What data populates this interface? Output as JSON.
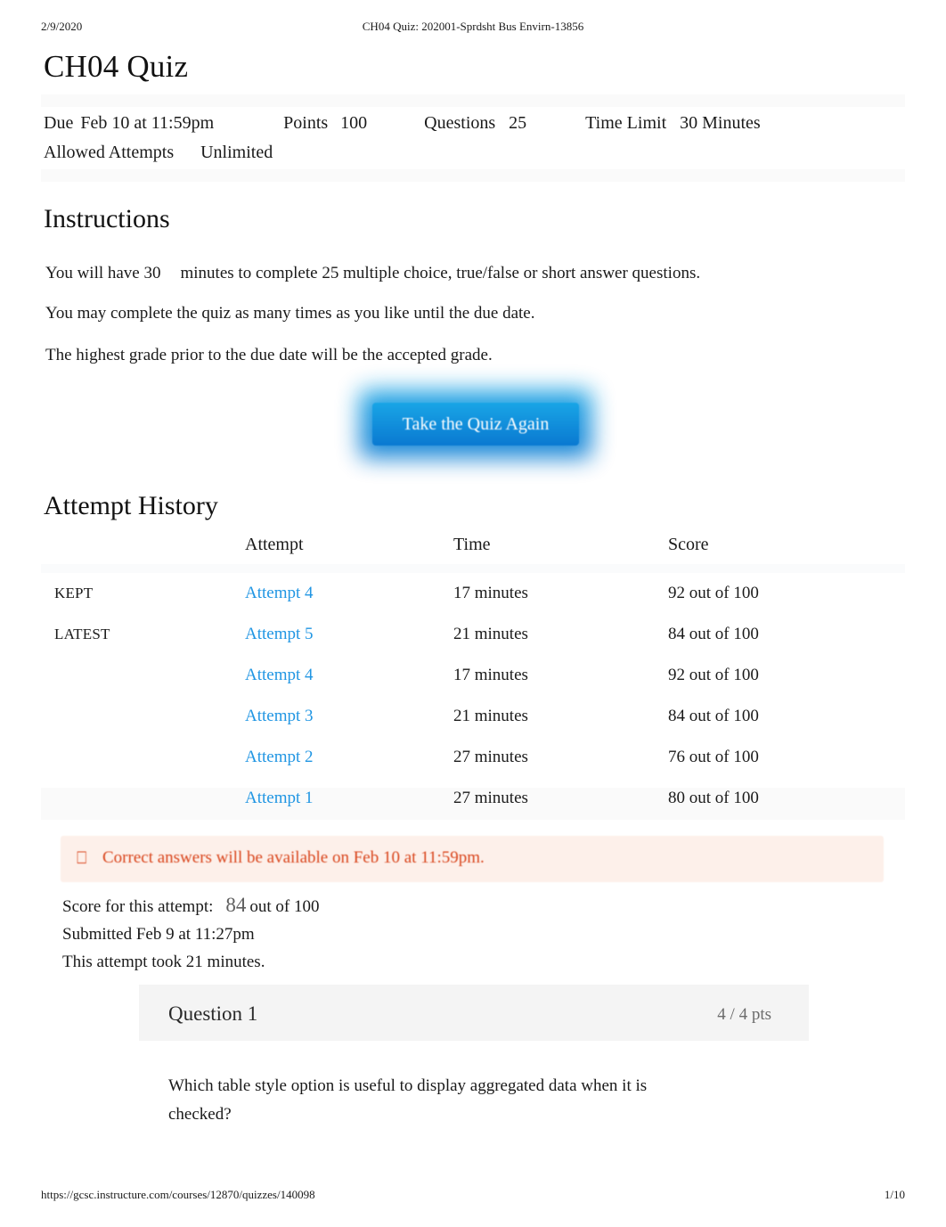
{
  "print": {
    "date": "2/9/2020",
    "doc_title": "CH04 Quiz: 202001-Sprdsht Bus Envirn-13856",
    "url": "https://gcsc.instructure.com/courses/12870/quizzes/140098",
    "page_number": "1/10"
  },
  "quiz": {
    "title": "CH04 Quiz",
    "details": {
      "due_label": "Due",
      "due_value": "Feb 10 at 11:59pm",
      "points_label": "Points",
      "points_value": "100",
      "questions_label": "Questions",
      "questions_value": "25",
      "time_limit_label": "Time Limit",
      "time_limit_value": "30 Minutes",
      "allowed_attempts_label": "Allowed Attempts",
      "allowed_attempts_value": "Unlimited"
    }
  },
  "instructions": {
    "heading": "Instructions",
    "line1_a": "You will have 30",
    "line1_b": "minutes to complete 25 multiple choice, true/false or short answer questions.",
    "line2": "You may complete the quiz as many times as you like until the due date.",
    "line3": "The highest grade prior to the due date will be the accepted grade."
  },
  "take_quiz_button": {
    "label": "Take the Quiz Again"
  },
  "attempt_history": {
    "heading": "Attempt History",
    "columns": {
      "flag": "",
      "attempt": "Attempt",
      "time": "Time",
      "score": "Score"
    },
    "rows": [
      {
        "flag": "KEPT",
        "attempt": "Attempt 4",
        "time": "17 minutes",
        "score": "92 out of 100"
      },
      {
        "flag": "LATEST",
        "attempt": "Attempt 5",
        "time": "21 minutes",
        "score": "84 out of 100"
      },
      {
        "flag": "",
        "attempt": "Attempt 4",
        "time": "17 minutes",
        "score": "92 out of 100"
      },
      {
        "flag": "",
        "attempt": "Attempt 3",
        "time": "21 minutes",
        "score": "84 out of 100"
      },
      {
        "flag": "",
        "attempt": "Attempt 2",
        "time": "27 minutes",
        "score": "76 out of 100"
      },
      {
        "flag": "",
        "attempt": "Attempt 1",
        "time": "27 minutes",
        "score": "80 out of 100"
      }
    ]
  },
  "notice": {
    "icon": "warning-icon",
    "icon_glyph": "⎕",
    "text": "Correct answers will be available on Feb 10 at 11:59pm."
  },
  "attempt_summary": {
    "score_label": "Score for this attempt:",
    "score_value": "84",
    "score_suffix": "out of 100",
    "submitted": "Submitted Feb 9 at 11:27pm",
    "duration": "This attempt took 21 minutes."
  },
  "question": {
    "number": "Question 1",
    "points": "4 / 4 pts",
    "text": "Which table style option is useful to display aggregated data when it is checked?"
  },
  "colors": {
    "link_blue": "#2196e3",
    "button_blue_top": "#19a5e6",
    "button_blue_bottom": "#0a79d1",
    "notice_bg": "#fdf0ea",
    "notice_text": "#d9451c",
    "question_header_bg": "#f4f4f4"
  }
}
